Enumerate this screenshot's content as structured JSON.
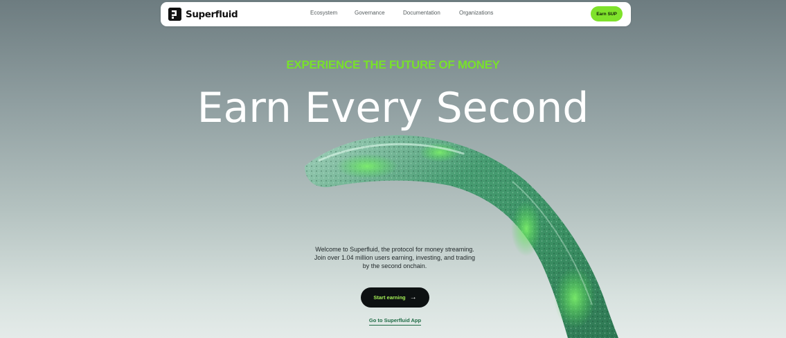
{
  "nav": {
    "brand": "Superfluid",
    "links": [
      "Ecosystem",
      "Governance",
      "Documentation",
      "Organizations"
    ],
    "cta": "Earn SUP"
  },
  "hero": {
    "eyebrow": "EXPERIENCE THE FUTURE OF MONEY",
    "title": "Earn Every Second",
    "description": [
      "Welcome to Superfluid, the protocol for money streaming.",
      "Join over 1.04 million users earning, investing, and trading",
      "by the second onchain."
    ],
    "primary_cta": "Start earning",
    "secondary_link": "Go to Superfluid App"
  },
  "colors": {
    "accent": "#7fe22b",
    "brand_dark": "#111111",
    "link_green": "#1f6b45"
  },
  "icons": {
    "logo": "superfluid-logo-icon",
    "arrow": "arrow-right-icon"
  }
}
